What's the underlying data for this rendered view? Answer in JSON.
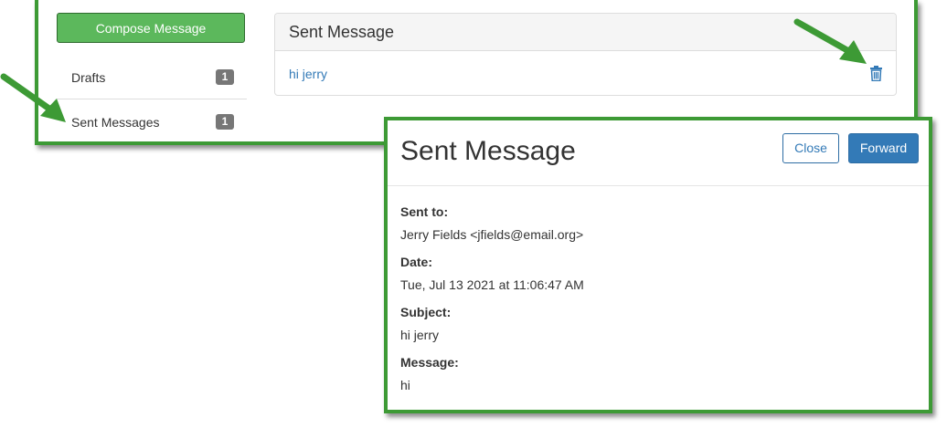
{
  "sidebar": {
    "compose_label": "Compose Message",
    "items": [
      {
        "label": "Drafts",
        "count": "1"
      },
      {
        "label": "Sent Messages",
        "count": "1"
      }
    ]
  },
  "list": {
    "heading": "Sent Message",
    "rows": [
      {
        "subject": "hi jerry",
        "action_icon": "trash-icon"
      }
    ]
  },
  "modal": {
    "title": "Sent Message",
    "close_label": "Close",
    "forward_label": "Forward",
    "fields": [
      {
        "label": "Sent to:",
        "value": "Jerry Fields <jfields@email.org>"
      },
      {
        "label": "Date:",
        "value": "Tue, Jul 13 2021 at 11:06:47 AM"
      },
      {
        "label": "Subject:",
        "value": "hi jerry"
      },
      {
        "label": "Message:",
        "value": "hi"
      }
    ]
  },
  "colors": {
    "annotation_green": "#3d9a35",
    "compose_green": "#5cb85c",
    "link_blue": "#337ab7",
    "badge_gray": "#777777"
  }
}
